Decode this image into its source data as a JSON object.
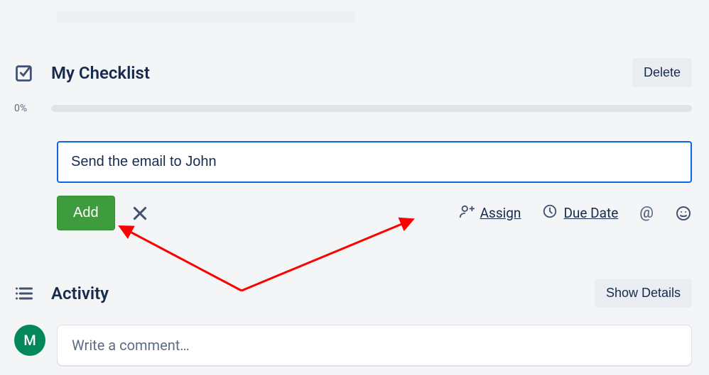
{
  "checklist": {
    "title": "My Checklist",
    "delete_label": "Delete",
    "progress_pct": "0%",
    "new_item_value": "Send the email to John",
    "add_label": "Add",
    "actions": {
      "assign": "Assign",
      "due_date": "Due Date",
      "mention": "@",
      "emoji": "☺"
    }
  },
  "activity": {
    "title": "Activity",
    "show_details_label": "Show Details",
    "comment_placeholder": "Write a comment…",
    "avatar_initial": "M"
  }
}
